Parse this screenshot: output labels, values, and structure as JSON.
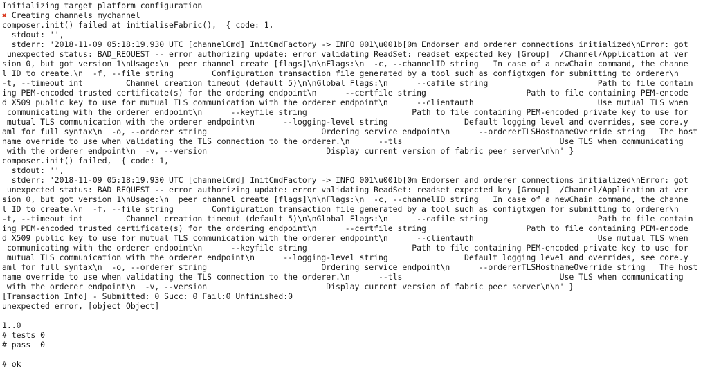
{
  "terminal": {
    "error_mark": "✖",
    "lines": [
      "Initializing target platform configuration",
      " Creating channels mychannel",
      "composer.init() failed at initialiseFabric(),  { code: 1,",
      "  stdout: '',",
      "  stderr: '2018-11-09 05:18:19.930 UTC [channelCmd] InitCmdFactory -> INFO 001\\u001b[0m Endorser and orderer connections initialized\\nError: got",
      " unexpected status: BAD_REQUEST -- error authorizing update: error validating ReadSet: readset expected key [Group]  /Channel/Application at ver",
      "sion 0, but got version 1\\nUsage:\\n  peer channel create [flags]\\n\\nFlags:\\n  -c, --channelID string   In case of a newChain command, the channe",
      "l ID to create.\\n  -f, --file string        Configuration transaction file generated by a tool such as configtxgen for submitting to orderer\\n",
      "-t, --timeout int         Channel creation timeout (default 5)\\n\\nGlobal Flags:\\n      --cafile string                       Path to file contain",
      "ing PEM-encoded trusted certificate(s) for the ordering endpoint\\n      --certfile string                     Path to file containing PEM-encode",
      "d X509 public key to use for mutual TLS communication with the orderer endpoint\\n      --clientauth                          Use mutual TLS when",
      " communicating with the orderer endpoint\\n      --keyfile string                      Path to file containing PEM-encoded private key to use for",
      " mutual TLS communication with the orderer endpoint\\n      --logging-level string                Default logging level and overrides, see core.y",
      "aml for full syntax\\n  -o, --orderer string                        Ordering service endpoint\\n      --ordererTLSHostnameOverride string   The host",
      "name override to use when validating the TLS connection to the orderer.\\n      --tls                                 Use TLS when communicating",
      " with the orderer endpoint\\n  -v, --version                         Display current version of fabric peer server\\n\\n' }",
      "composer.init() failed,  { code: 1,",
      "  stdout: '',",
      "  stderr: '2018-11-09 05:18:19.930 UTC [channelCmd] InitCmdFactory -> INFO 001\\u001b[0m Endorser and orderer connections initialized\\nError: got",
      " unexpected status: BAD_REQUEST -- error authorizing update: error validating ReadSet: readset expected key [Group]  /Channel/Application at ver",
      "sion 0, but got version 1\\nUsage:\\n  peer channel create [flags]\\n\\nFlags:\\n  -c, --channelID string   In case of a newChain command, the channe",
      "l ID to create.\\n  -f, --file string        Configuration transaction file generated by a tool such as configtxgen for submitting to orderer\\n",
      "-t, --timeout int         Channel creation timeout (default 5)\\n\\nGlobal Flags:\\n      --cafile string                       Path to file contain",
      "ing PEM-encoded trusted certificate(s) for the ordering endpoint\\n      --certfile string                     Path to file containing PEM-encode",
      "d X509 public key to use for mutual TLS communication with the orderer endpoint\\n      --clientauth                          Use mutual TLS when",
      " communicating with the orderer endpoint\\n      --keyfile string                      Path to file containing PEM-encoded private key to use for",
      " mutual TLS communication with the orderer endpoint\\n      --logging-level string                Default logging level and overrides, see core.y",
      "aml for full syntax\\n  -o, --orderer string                        Ordering service endpoint\\n      --ordererTLSHostnameOverride string   The host",
      "name override to use when validating the TLS connection to the orderer.\\n      --tls                                 Use TLS when communicating",
      " with the orderer endpoint\\n  -v, --version                         Display current version of fabric peer server\\n\\n' }",
      "[Transaction Info] - Submitted: 0 Succ: 0 Fail:0 Unfinished:0",
      "unexpected error, [object Object]",
      "",
      "1..0",
      "# tests 0",
      "# pass  0",
      "",
      "# ok"
    ]
  }
}
